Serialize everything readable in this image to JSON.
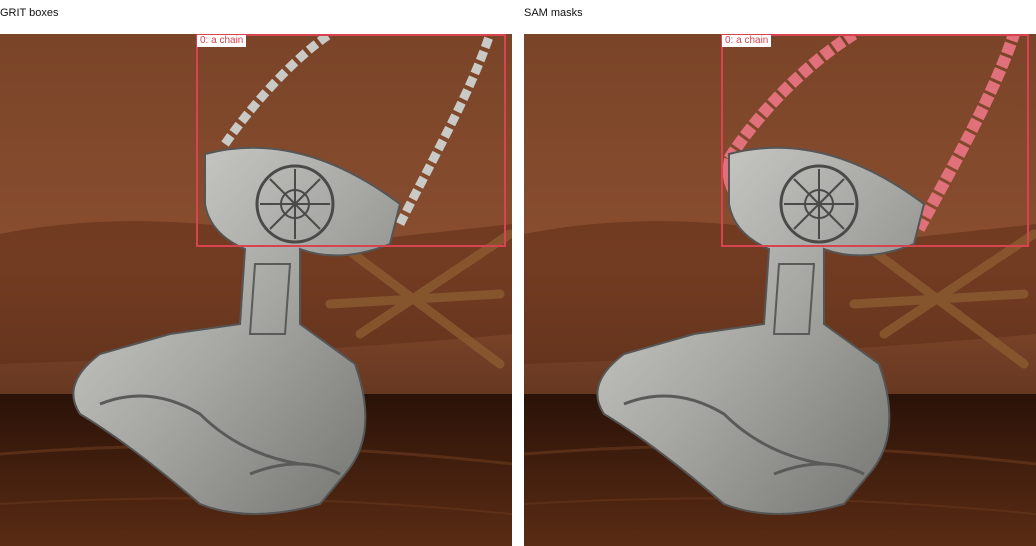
{
  "panels": [
    {
      "title": "GRIT boxes",
      "kind": "boxes"
    },
    {
      "title": "SAM masks",
      "kind": "masks"
    }
  ],
  "detection": {
    "label": "0: a chain"
  },
  "colors": {
    "box": "#d9434f",
    "mask": "#e0707a",
    "leather": "#6b3620",
    "wood": "#4a2412",
    "metal": "#b9b9b6"
  }
}
